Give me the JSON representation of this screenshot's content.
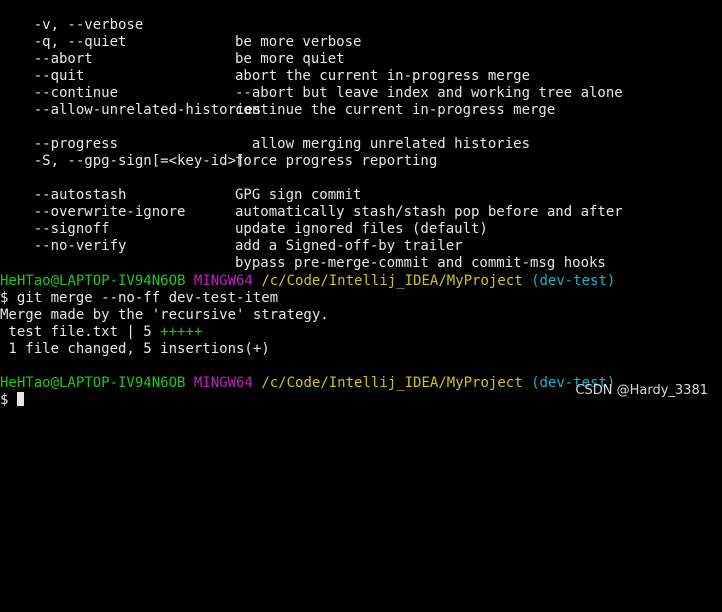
{
  "help_options": [
    {
      "option": "    -v, --verbose",
      "description": "be more verbose"
    },
    {
      "option": "    -q, --quiet",
      "description": "be more quiet"
    },
    {
      "option": "    --abort",
      "description": "abort the current in-progress merge"
    },
    {
      "option": "    --quit",
      "description": "--abort but leave index and working tree alone"
    },
    {
      "option": "    --continue",
      "description": "continue the current in-progress merge"
    },
    {
      "option": "    --allow-unrelated-histories",
      "description": ""
    },
    {
      "option": "",
      "description": "  allow merging unrelated histories"
    },
    {
      "option": "    --progress",
      "description": "force progress reporting"
    },
    {
      "option": "    -S, --gpg-sign[=<key-id>]",
      "description": ""
    },
    {
      "option": "",
      "description": "GPG sign commit"
    },
    {
      "option": "    --autostash",
      "description": "automatically stash/stash pop before and after"
    },
    {
      "option": "    --overwrite-ignore",
      "description": "update ignored files (default)"
    },
    {
      "option": "    --signoff",
      "description": "add a Signed-off-by trailer"
    },
    {
      "option": "    --no-verify",
      "description": "bypass pre-merge-commit and commit-msg hooks"
    }
  ],
  "prompt1": {
    "user_host": "HeHTao@LAPTOP-IV94N6OB",
    "shell": "MINGW64",
    "path": "/c/Code/Intellij_IDEA/MyProject",
    "branch": "(dev-test)"
  },
  "command": "$ git merge --no-ff dev-test-item",
  "merge_output": {
    "strategy_line": "Merge made by the 'recursive' strategy.",
    "file_line_prefix": " test file.txt | 5 ",
    "file_line_plus": "+++++",
    "summary_line": " 1 file changed, 5 insertions(+)"
  },
  "prompt2": {
    "user_host": "HeHTao@LAPTOP-IV94N6OB",
    "shell": "MINGW64",
    "path": "/c/Code/Intellij_IDEA/MyProject",
    "branch": "(dev-test)"
  },
  "final_prompt": "$ ",
  "watermark": "CSDN @Hardy_3381",
  "colors": {
    "background": "#000000",
    "text": "#e6e6e6",
    "user_host": "#1ec81e",
    "shell": "#c020c0",
    "path": "#d2c21e",
    "branch": "#1ab6c8"
  }
}
